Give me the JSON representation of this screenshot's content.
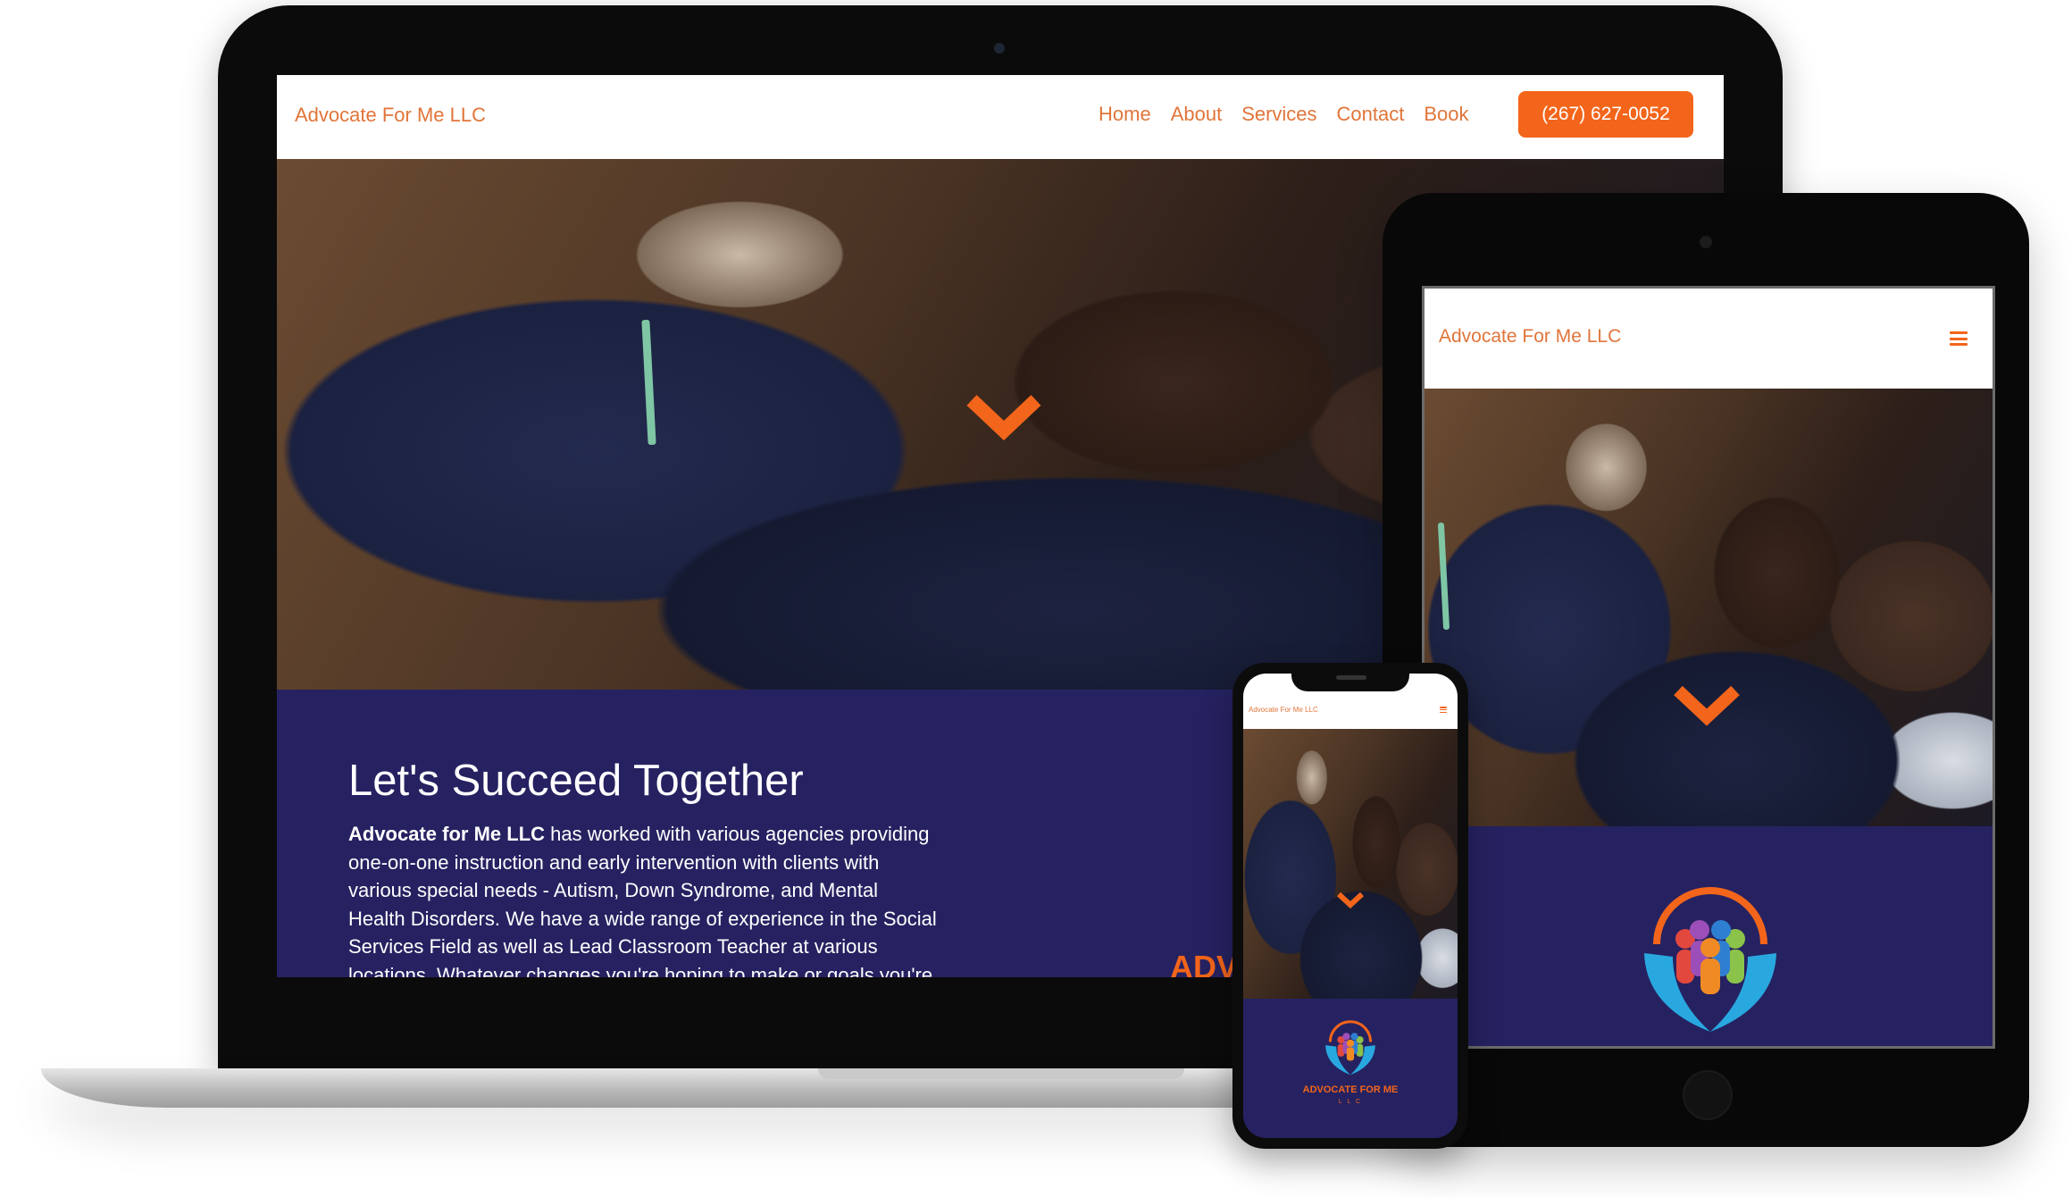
{
  "site": {
    "brand": "Advocate For Me LLC",
    "nav": [
      "Home",
      "About",
      "Services",
      "Contact",
      "Book"
    ],
    "phone": "(267) 627-0052"
  },
  "hero": {
    "heading": "Let's Succeed Together",
    "intro_bold": "Advocate for Me LLC",
    "intro_lines": [
      " has worked with various agencies providing",
      "one-on-one instruction and early intervention with clients with",
      "various special needs - Autism, Down Syndrome, and Mental",
      "Health Disorders. We have a wide range of experience in the Social",
      "Services Field as well as Lead Classroom Teacher at various",
      "locations. Whatever changes you're hoping to make or goals you're"
    ],
    "partial_logo_text": "ADV"
  },
  "logo": {
    "name": "ADVOCATE FOR ME",
    "suffix": "L L C"
  },
  "colors": {
    "accent": "#f3651b",
    "link": "#e0753a",
    "navy": "#262261",
    "hands": "#29a8e0"
  },
  "icons": [
    "chevron-down-icon",
    "hamburger-menu-icon",
    "family-hands-logo-icon"
  ]
}
